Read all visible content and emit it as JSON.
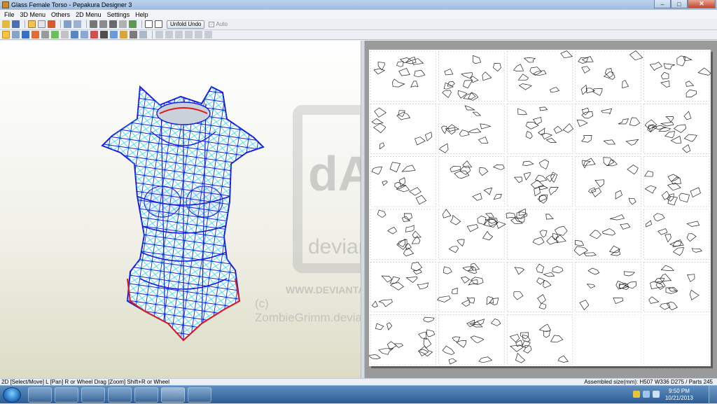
{
  "window": {
    "title": "Glass Female Torso - Pepakura Designer 3",
    "controls": {
      "minimize": "–",
      "maximize": "□",
      "close": "✕"
    }
  },
  "menu": [
    "File",
    "3D Menu",
    "Others",
    "2D Menu",
    "Settings",
    "Help"
  ],
  "toolbar": {
    "unfold_undo_label": "Unfold Undo",
    "auto_label": "Auto",
    "auto_checked": true
  },
  "watermark": {
    "logo_text": "dA",
    "brand_text": "deviantART",
    "url_text": "WWW.DEVIANTART.COM",
    "credit_text": "(c) ZombieGrimm.deviantart.com"
  },
  "unfold_layout": {
    "pages_per_row": 5,
    "page_count": 28
  },
  "status": {
    "left": "2D [Select/Move] L [Pan] R or Wheel Drag [Zoom] Shift+R or Wheel",
    "right": "Assembled size(mm): H507 W336 D275 / Parts 245"
  },
  "taskbar": {
    "time": "9:50 PM",
    "date": "10/21/2013",
    "apps": [
      "ie-icon",
      "box-app-icon",
      "leaf-app-icon",
      "media-icon",
      "game-icon",
      "pepakura-icon",
      "graphics-icon"
    ]
  },
  "colors": {
    "wire_blue": "#1a1adb",
    "wire_cyan": "#18d8f0",
    "edge_red": "#e01a1a",
    "accent": "#2b5c93"
  }
}
